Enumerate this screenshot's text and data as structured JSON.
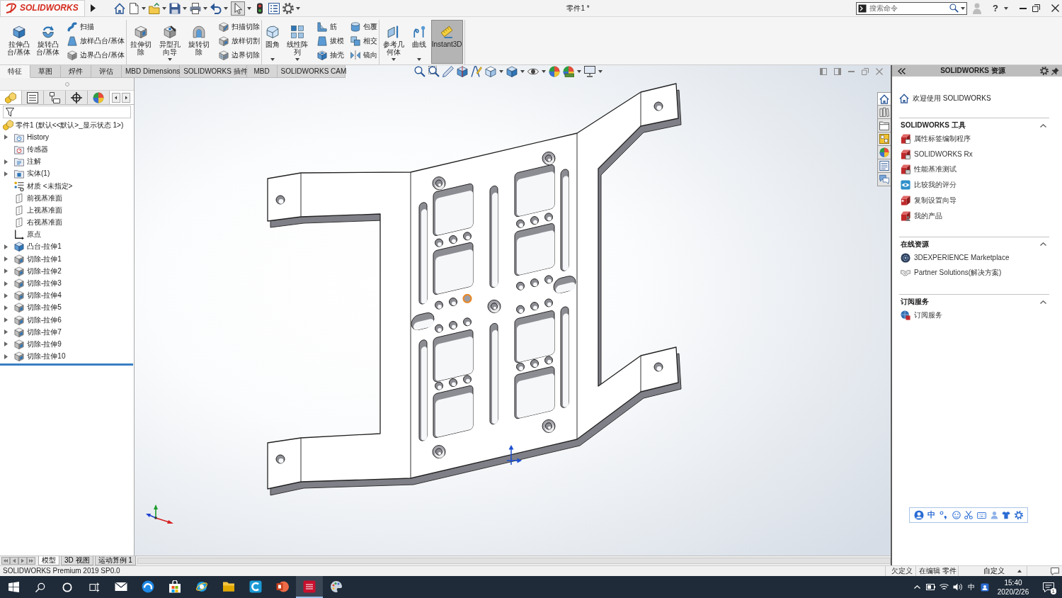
{
  "title_bar": {
    "logo": "SOLIDWORKS",
    "quick_access": [
      {
        "kind": "home",
        "dropdown": false,
        "pressed": false
      },
      {
        "kind": "new",
        "dropdown": true,
        "pressed": false
      },
      {
        "kind": "open",
        "dropdown": true,
        "pressed": false
      },
      {
        "kind": "save",
        "dropdown": true,
        "pressed": false
      },
      {
        "kind": "print",
        "dropdown": true,
        "pressed": false
      },
      {
        "kind": "undo",
        "dropdown": true,
        "pressed": false
      },
      {
        "kind": "select",
        "dropdown": true,
        "pressed": true
      },
      {
        "kind": "rebuild",
        "dropdown": false,
        "pressed": false
      },
      {
        "kind": "properties",
        "dropdown": false,
        "pressed": false
      },
      {
        "kind": "options",
        "dropdown": true,
        "pressed": false
      }
    ],
    "document_title": "零件1 *",
    "search": {
      "placeholder": "搜索命令"
    },
    "help": "?"
  },
  "ribbon": {
    "groups": [
      {
        "large": [
          {
            "kind": "extrude",
            "label": "拉伸凸台/基体",
            "dropdown": false,
            "pressed": false
          },
          {
            "kind": "revolve",
            "label": "旋转凸台/基体",
            "dropdown": false,
            "pressed": false
          }
        ],
        "columns": [
          [
            {
              "kind": "sweep",
              "label": "扫描"
            },
            {
              "kind": "loft",
              "label": "放样凸台/基体"
            },
            {
              "kind": "boundary",
              "label": "边界凸台/基体"
            }
          ]
        ]
      },
      {
        "large": [
          {
            "kind": "extrudecut",
            "label": "拉伸切除",
            "dropdown": false,
            "pressed": false
          },
          {
            "kind": "holewizard",
            "label": "异型孔向导",
            "dropdown": true,
            "pressed": false
          },
          {
            "kind": "revolvecut",
            "label": "旋转切除",
            "dropdown": false,
            "pressed": false
          }
        ],
        "columns": [
          [
            {
              "kind": "sweepcut",
              "label": "扫描切除"
            },
            {
              "kind": "loftcut",
              "label": "放样切割"
            },
            {
              "kind": "boundarycut",
              "label": "边界切除"
            }
          ]
        ]
      },
      {
        "large": [
          {
            "kind": "fillet",
            "label": "圆角",
            "dropdown": true,
            "pressed": false
          },
          {
            "kind": "pattern",
            "label": "线性阵列",
            "dropdown": true,
            "pressed": false
          }
        ],
        "columns": [
          [
            {
              "kind": "rib",
              "label": "筋"
            },
            {
              "kind": "draft",
              "label": "拔模"
            },
            {
              "kind": "shell",
              "label": "抽壳"
            }
          ],
          [
            {
              "kind": "wrap",
              "label": "包覆"
            },
            {
              "kind": "intersect",
              "label": "相交"
            },
            {
              "kind": "mirror",
              "label": "镜向"
            }
          ]
        ]
      },
      {
        "large": [
          {
            "kind": "reference",
            "label": "参考几何体",
            "dropdown": true,
            "pressed": false
          },
          {
            "kind": "curves",
            "label": "曲线",
            "dropdown": true,
            "pressed": false
          },
          {
            "kind": "instant3d",
            "label": "Instant3D",
            "dropdown": false,
            "pressed": true
          }
        ]
      }
    ]
  },
  "command_tabs": [
    {
      "label": "特征",
      "selected": true
    },
    {
      "label": "草图",
      "selected": false
    },
    {
      "label": "焊件",
      "selected": false
    },
    {
      "label": "评估",
      "selected": false
    },
    {
      "label": "MBD Dimensions",
      "selected": false
    },
    {
      "label": "SOLIDWORKS 插件",
      "selected": false
    },
    {
      "label": "MBD",
      "selected": false
    },
    {
      "label": "SOLIDWORKS CAM",
      "selected": false
    }
  ],
  "view_toolbar": [
    {
      "kind": "zoomfit",
      "dropdown": false
    },
    {
      "kind": "zoomarea",
      "dropdown": false
    },
    {
      "kind": "previous",
      "dropdown": false
    },
    {
      "kind": "section",
      "dropdown": false
    },
    {
      "kind": "annotation",
      "dropdown": false
    },
    {
      "kind": "orientation",
      "dropdown": true
    },
    {
      "kind": "display",
      "dropdown": true
    },
    {
      "kind": "hideshow",
      "dropdown": true
    },
    {
      "kind": "appearance",
      "dropdown": false
    },
    {
      "kind": "scene",
      "dropdown": true
    },
    {
      "kind": "settings",
      "dropdown": true
    }
  ],
  "feature_manager": {
    "tabs": [
      {
        "kind": "tree",
        "selected": true
      },
      {
        "kind": "property",
        "selected": false
      },
      {
        "kind": "config",
        "selected": false
      },
      {
        "kind": "dimxpert",
        "selected": false
      },
      {
        "kind": "display",
        "selected": false
      }
    ],
    "tree": {
      "kind": "part",
      "label": "零件1 (默认<<默认>_显示状态 1>)",
      "children": [
        {
          "kind": "history",
          "label": "History",
          "expandable": true
        },
        {
          "kind": "sensor",
          "label": "传感器",
          "expandable": false
        },
        {
          "kind": "annotation",
          "label": "注解",
          "expandable": true
        },
        {
          "kind": "body",
          "label": "实体(1)",
          "expandable": true
        },
        {
          "kind": "material",
          "label": "材质 <未指定>",
          "expandable": false
        },
        {
          "kind": "plane",
          "label": "前视基准面",
          "expandable": false
        },
        {
          "kind": "plane",
          "label": "上视基准面",
          "expandable": false
        },
        {
          "kind": "plane",
          "label": "右视基准面",
          "expandable": false
        },
        {
          "kind": "origin",
          "label": "原点",
          "expandable": false
        },
        {
          "kind": "boss",
          "label": "凸台-拉伸1",
          "expandable": true
        },
        {
          "kind": "cut",
          "label": "切除-拉伸1",
          "expandable": true
        },
        {
          "kind": "cut",
          "label": "切除-拉伸2",
          "expandable": true
        },
        {
          "kind": "cut",
          "label": "切除-拉伸3",
          "expandable": true
        },
        {
          "kind": "cut",
          "label": "切除-拉伸4",
          "expandable": true
        },
        {
          "kind": "cut",
          "label": "切除-拉伸5",
          "expandable": true
        },
        {
          "kind": "cut",
          "label": "切除-拉伸6",
          "expandable": true
        },
        {
          "kind": "cut",
          "label": "切除-拉伸7",
          "expandable": true
        },
        {
          "kind": "cut",
          "label": "切除-拉伸9",
          "expandable": true
        },
        {
          "kind": "cut",
          "label": "切除-拉伸10",
          "expandable": true
        }
      ]
    }
  },
  "task_pane": {
    "tabs": [
      {
        "kind": "home",
        "selected": true
      },
      {
        "kind": "library",
        "selected": false
      },
      {
        "kind": "folder",
        "selected": false
      },
      {
        "kind": "palette",
        "selected": false
      },
      {
        "kind": "appearances",
        "selected": false
      },
      {
        "kind": "properties",
        "selected": false
      },
      {
        "kind": "forum",
        "selected": false
      }
    ],
    "title": "SOLIDWORKS 资源",
    "welcome": "欢迎使用 SOLIDWORKS",
    "sections": [
      {
        "title": "SOLIDWORKS 工具",
        "expanded": true,
        "items": [
          {
            "kind": "propertytab",
            "label": "属性标签编制程序"
          },
          {
            "kind": "rx",
            "label": "SOLIDWORKS Rx"
          },
          {
            "kind": "benchmark",
            "label": "性能基准测试"
          },
          {
            "kind": "compare",
            "label": "比较我的评分"
          },
          {
            "kind": "copysettings",
            "label": "复制设置向导"
          },
          {
            "kind": "products",
            "label": "我的产品"
          }
        ]
      },
      {
        "title": "在线资源",
        "expanded": true,
        "items": [
          {
            "kind": "marketplace",
            "label": "3DEXPERIENCE Marketplace"
          },
          {
            "kind": "partner",
            "label": "Partner Solutions(解决方案)"
          }
        ]
      },
      {
        "title": "订阅服务",
        "expanded": true,
        "items": [
          {
            "kind": "subscription",
            "label": "订阅服务"
          }
        ]
      }
    ]
  },
  "ime_bar": {
    "mode": "中"
  },
  "bottom_tabs": [
    {
      "label": "模型",
      "selected": true
    },
    {
      "label": "3D 视图",
      "selected": false
    },
    {
      "label": "运动算例 1",
      "selected": false
    }
  ],
  "status_bar": {
    "product": "SOLIDWORKS Premium 2019 SP0.0",
    "definition": "欠定义",
    "editing": "在编辑 零件",
    "units": "自定义"
  },
  "taskbar": {
    "apps": [
      {
        "kind": "mail",
        "active": false
      },
      {
        "kind": "edge",
        "active": false
      },
      {
        "kind": "store",
        "active": false
      },
      {
        "kind": "ie",
        "active": false
      },
      {
        "kind": "explorer",
        "active": false
      },
      {
        "kind": "capp",
        "active": false
      },
      {
        "kind": "powerpoint",
        "active": false
      },
      {
        "kind": "solidworks",
        "active": true
      },
      {
        "kind": "paint",
        "active": false
      }
    ],
    "tray": {
      "input": "中",
      "time": "15:40",
      "date": "2020/2/26",
      "notifications": "1"
    }
  }
}
